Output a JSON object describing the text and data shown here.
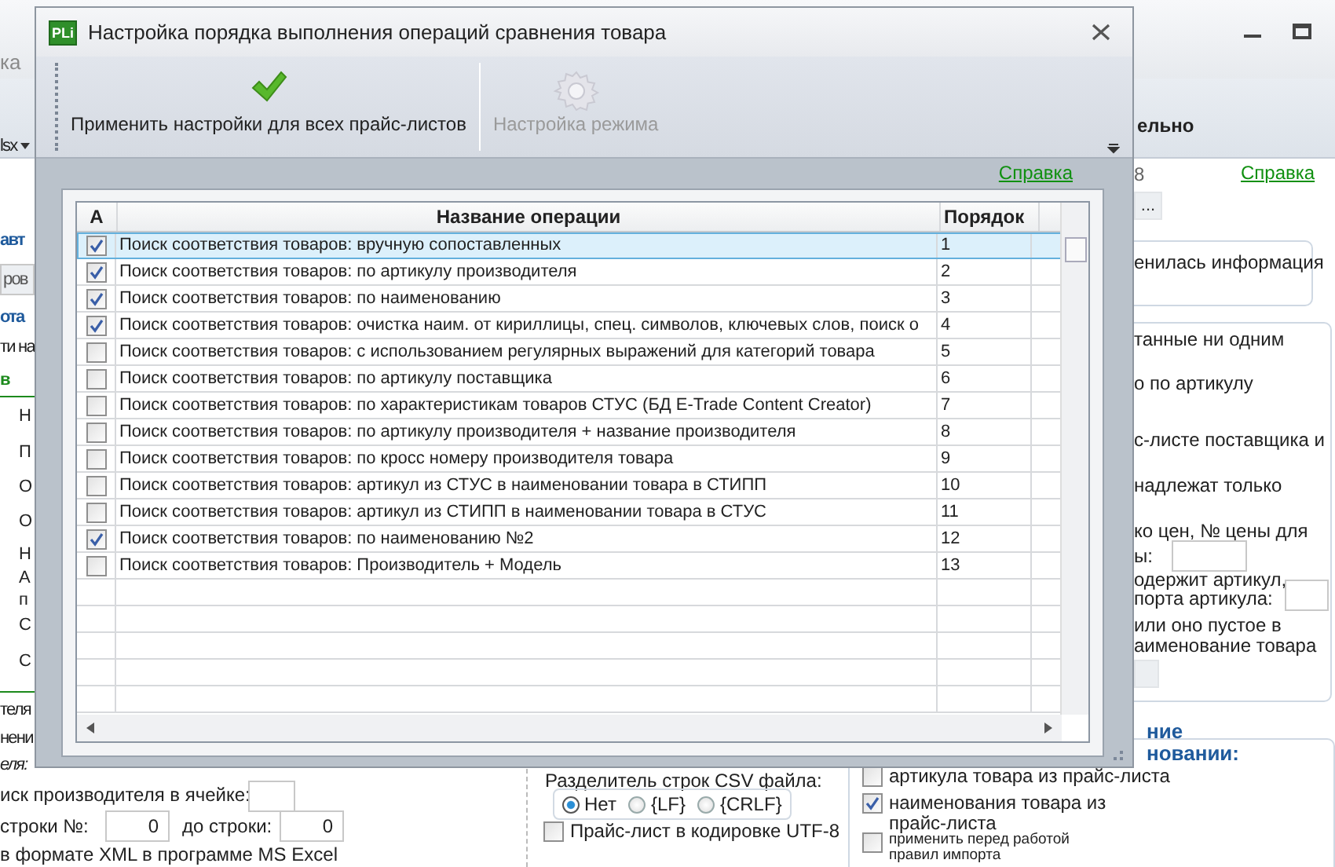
{
  "background_window": {
    "title": "ка",
    "fragments": [
      {
        "kind": "menu",
        "text": "lsx"
      },
      {
        "kind": "toolbar_label",
        "text": "ельно"
      },
      {
        "kind": "muted",
        "text": "8"
      },
      {
        "kind": "link",
        "text": "Справка"
      },
      {
        "kind": "button",
        "text": "..."
      },
      {
        "kind": "text",
        "text": "енилась информация"
      },
      {
        "kind": "text",
        "text": "танные ни одним"
      },
      {
        "kind": "text",
        "text": "о по артикулу"
      },
      {
        "kind": "text",
        "text": "с-листе поставщика и"
      },
      {
        "kind": "text",
        "text": "надлежат только"
      },
      {
        "kind": "text",
        "text": "ко цен, № цены для"
      },
      {
        "kind": "text",
        "text": "ы:"
      },
      {
        "kind": "field"
      },
      {
        "kind": "text",
        "text": "одержит артикул,"
      },
      {
        "kind": "text",
        "text": "порта артикула:"
      },
      {
        "kind": "field"
      },
      {
        "kind": "text",
        "text": "или оно пустое в"
      },
      {
        "kind": "text",
        "text": "аименование товара"
      },
      {
        "kind": "button"
      },
      {
        "kind": "heading",
        "text": "ние"
      },
      {
        "kind": "heading",
        "text": "новании:"
      },
      {
        "kind": "heading",
        "text": "авт"
      },
      {
        "kind": "field",
        "value": "ров"
      },
      {
        "kind": "heading",
        "text": "ота"
      },
      {
        "kind": "text",
        "text": "ти на"
      },
      {
        "kind": "green",
        "text": "в"
      },
      {
        "kind": "text",
        "text": "Н"
      },
      {
        "kind": "text",
        "text": "П"
      },
      {
        "kind": "text",
        "text": "О"
      },
      {
        "kind": "text",
        "text": "О"
      },
      {
        "kind": "text",
        "text": "Н"
      },
      {
        "kind": "text",
        "text": "А"
      },
      {
        "kind": "text",
        "text": "п"
      },
      {
        "kind": "text",
        "text": "С"
      },
      {
        "kind": "text",
        "text": "С"
      },
      {
        "kind": "text",
        "text": "теля"
      },
      {
        "kind": "text",
        "text": "нени"
      },
      {
        "kind": "italic",
        "text": "еля:"
      },
      {
        "kind": "text",
        "text": "иск производителя в ячейке:"
      },
      {
        "kind": "field"
      },
      {
        "kind": "text",
        "text": "строки №:"
      },
      {
        "kind": "field",
        "value": "0"
      },
      {
        "kind": "text",
        "text": "до строки:"
      },
      {
        "kind": "field",
        "value": "0"
      },
      {
        "kind": "text",
        "text": "в формате XML в программе MS Excel"
      },
      {
        "kind": "text",
        "text": "Разделитель строк CSV файла:"
      },
      {
        "kind": "radio_group",
        "options": [
          {
            "label": "Нет",
            "selected": true
          },
          {
            "label": "{LF}",
            "selected": false
          },
          {
            "label": "{CRLF}",
            "selected": false
          }
        ]
      },
      {
        "kind": "checkbox",
        "text": "Прайс-лист в кодировке UTF-8",
        "checked": false
      },
      {
        "kind": "checkbox",
        "text": "артикула товара из прайс-листа",
        "checked": false
      },
      {
        "kind": "checkbox",
        "text": "наименования товара из прайс-листа",
        "checked": true
      },
      {
        "kind": "small_checkbox",
        "text": "применить перед работой правил импорта",
        "checked": false
      }
    ]
  },
  "dialog": {
    "title": "Настройка порядка выполнения операций сравнения товара",
    "logo": "PLi",
    "toolbar": [
      {
        "kind": "check",
        "label": "Применить настройки для всех прайс-листов",
        "disabled": false
      },
      {
        "kind": "gear",
        "label": "Настройка режима",
        "disabled": true
      }
    ],
    "help_link": "Справка",
    "table": {
      "columns": [
        "А",
        "Название операции",
        "Порядок"
      ],
      "rows": [
        {
          "enabled": true,
          "name": "Поиск соответствия товаров: вручную сопоставленных",
          "order": "1",
          "selected": true
        },
        {
          "enabled": true,
          "name": "Поиск соответствия товаров: по артикулу производителя",
          "order": "2",
          "selected": false
        },
        {
          "enabled": true,
          "name": "Поиск соответствия товаров: по наименованию",
          "order": "3",
          "selected": false
        },
        {
          "enabled": true,
          "name": "Поиск соответствия товаров: очистка наим. от кириллицы, спец. символов, ключевых слов, поиск о",
          "order": "4",
          "selected": false
        },
        {
          "enabled": false,
          "name": "Поиск соответствия товаров: с использованием регулярных выражений для категорий товара",
          "order": "5",
          "selected": false
        },
        {
          "enabled": false,
          "name": "Поиск соответствия товаров: по артикулу поставщика",
          "order": "6",
          "selected": false
        },
        {
          "enabled": false,
          "name": "Поиск соответствия товаров: по характеристикам товаров СТУС (БД E-Trade Content Creator)",
          "order": "7",
          "selected": false
        },
        {
          "enabled": false,
          "name": "Поиск соответствия товаров: по артикулу производителя + название производителя",
          "order": "8",
          "selected": false
        },
        {
          "enabled": false,
          "name": "Поиск соответствия товаров: по кросс номеру производителя товара",
          "order": "9",
          "selected": false
        },
        {
          "enabled": false,
          "name": "Поиск соответствия товаров: артикул из СТУС в наименовании товара в СТИПП",
          "order": "10",
          "selected": false
        },
        {
          "enabled": false,
          "name": "Поиск соответствия товаров: артикул из СТИПП в наименовании товара в СТУС",
          "order": "11",
          "selected": false
        },
        {
          "enabled": true,
          "name": "Поиск соответствия товаров: по наименованию №2",
          "order": "12",
          "selected": false
        },
        {
          "enabled": false,
          "name": "Поиск соответствия товаров: Производитель + Модель",
          "order": "13",
          "selected": false
        }
      ]
    }
  }
}
